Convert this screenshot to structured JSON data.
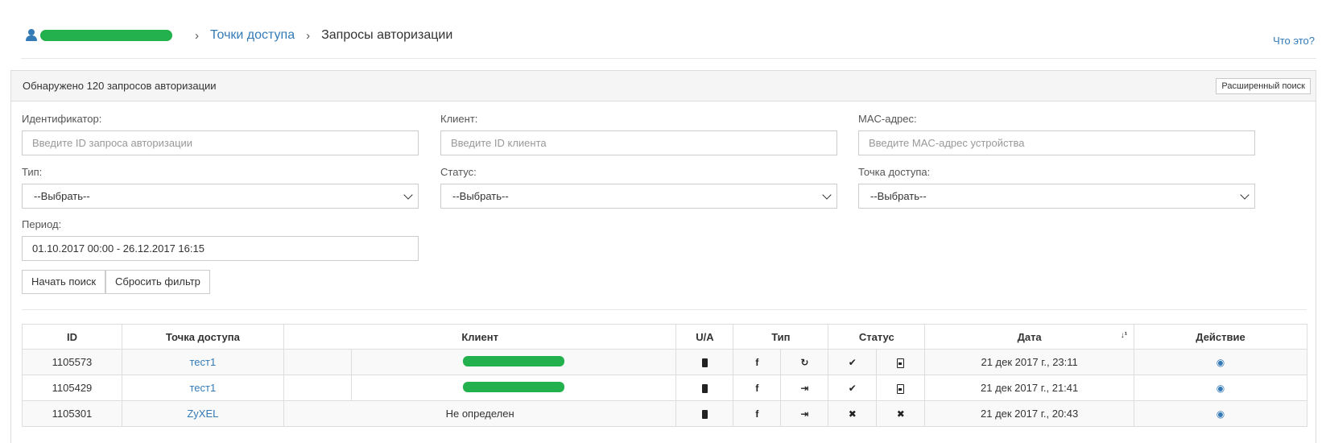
{
  "breadcrumb": {
    "user_redacted": "",
    "sep1": "›",
    "access_points": "Точки доступа",
    "sep2": "›",
    "current": "Запросы авторизации"
  },
  "help_link": "Что это?",
  "panel": {
    "title": "Обнаружено 120 запросов авторизации",
    "advanced_search": "Расширенный поиск"
  },
  "filters": {
    "id_label": "Идентификатор:",
    "id_placeholder": "Введите ID запроса авторизации",
    "client_label": "Клиент:",
    "client_placeholder": "Введите ID клиента",
    "mac_label": "MAC-адрес:",
    "mac_placeholder": "Введите MAC-адрес устройства",
    "type_label": "Тип:",
    "type_value": "--Выбрать--",
    "status_label": "Статус:",
    "status_value": "--Выбрать--",
    "ap_label": "Точка доступа:",
    "ap_value": "--Выбрать--",
    "period_label": "Период:",
    "period_value": "01.10.2017 00:00 - 26.12.2017 16:15",
    "search_btn": "Начать поиск",
    "reset_btn": "Сбросить фильтр"
  },
  "table": {
    "headers": {
      "id": "ID",
      "ap": "Точка доступа",
      "client": "Клиент",
      "ua": "U/A",
      "type": "Тип",
      "status": "Статус",
      "date": "Дата",
      "action": "Действие"
    },
    "rows": [
      {
        "id": "1105573",
        "ap": "тест1",
        "client": "",
        "client_redacted": true,
        "ua_icon": "mobile-icon",
        "type_social": "f",
        "type_icon": "↻",
        "status_icon": "✔",
        "status2_icon": "id-badge-icon",
        "date": "21 дек 2017 г., 23:11",
        "action_icon": "eye-icon"
      },
      {
        "id": "1105429",
        "ap": "тест1",
        "client": "",
        "client_redacted": true,
        "ua_icon": "mobile-icon",
        "type_social": "f",
        "type_icon": "⇥",
        "status_icon": "✔",
        "status2_icon": "id-badge-icon",
        "date": "21 дек 2017 г., 21:41",
        "action_icon": "eye-icon"
      },
      {
        "id": "1105301",
        "ap": "ZyXEL",
        "client": "Не определен",
        "client_redacted": false,
        "ua_icon": "mobile-icon",
        "type_social": "f",
        "type_icon": "⇥",
        "status_icon": "✖",
        "status2_icon": "✖",
        "date": "21 дек 2017 г., 20:43",
        "action_icon": "eye-icon"
      }
    ]
  },
  "colors": {
    "link": "#337ab7",
    "redaction": "#23b14d",
    "border": "#dddddd",
    "panel_head_bg": "#f5f5f5"
  }
}
